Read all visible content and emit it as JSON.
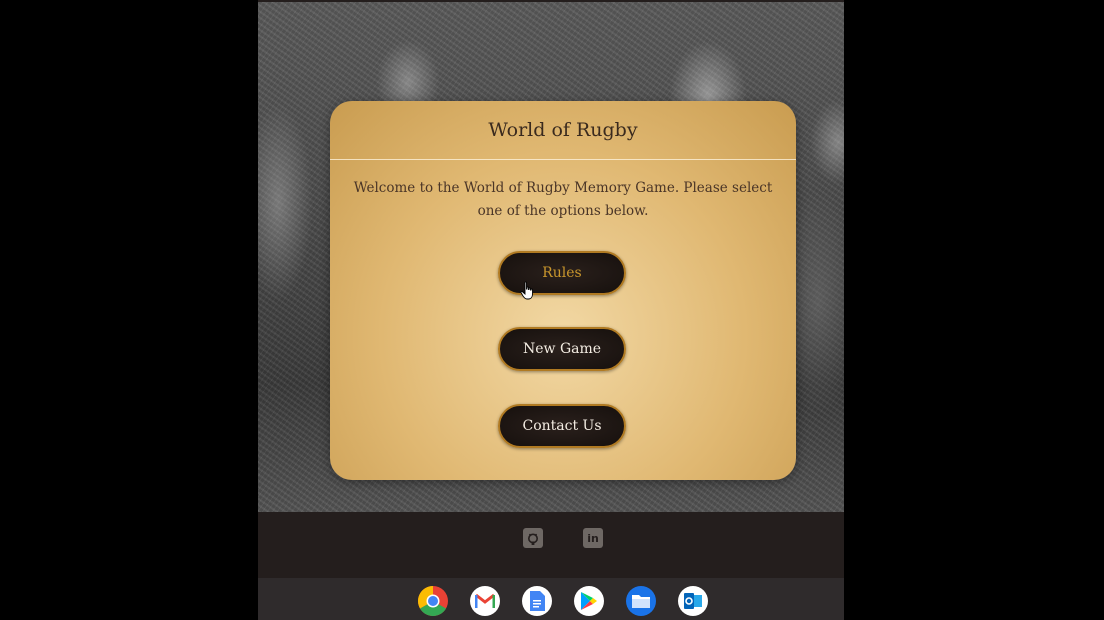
{
  "card": {
    "title": "World of Rugby",
    "text": "Welcome to the World of Rugby Memory Game. Please select one of the options below."
  },
  "menu": {
    "rules_label": "Rules",
    "new_game_label": "New Game",
    "contact_label": "Contact Us"
  },
  "footer": {
    "icons": [
      "github-icon",
      "linkedin-icon"
    ],
    "linkedin_glyph": "in"
  },
  "shelf": {
    "icons": [
      "chrome-icon",
      "gmail-icon",
      "docs-icon",
      "play-store-icon",
      "files-icon",
      "outlook-icon"
    ]
  },
  "colors": {
    "card": "#e0b872",
    "button_bg": "#16100d",
    "button_border": "#b07a22",
    "rules_text": "#c9962c",
    "footer": "#241e1d"
  }
}
